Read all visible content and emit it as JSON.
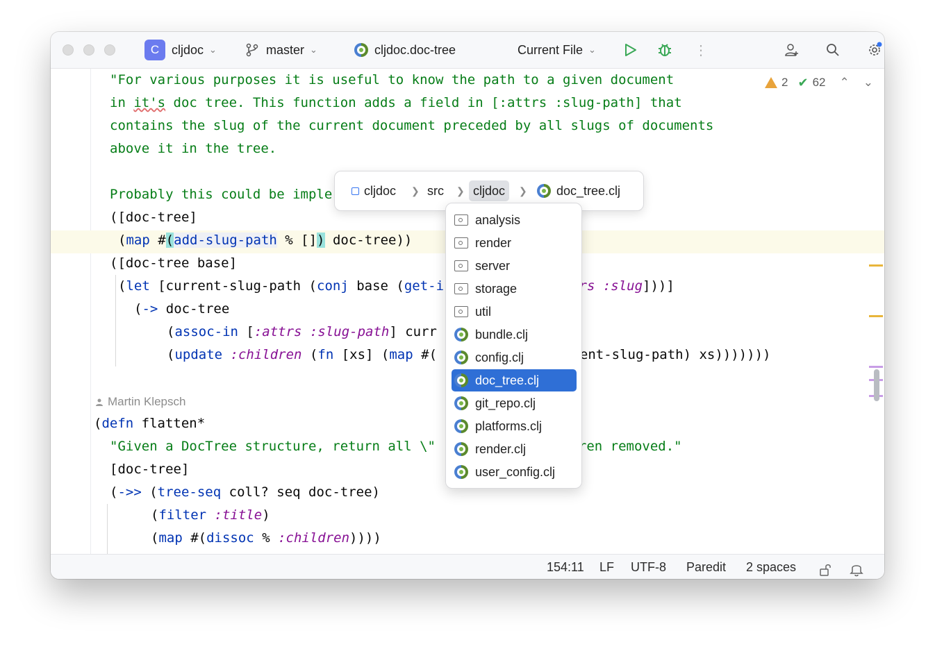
{
  "titlebar": {
    "project_initial": "C",
    "project_name": "cljdoc",
    "branch": "master",
    "current_namespace": "cljdoc.doc-tree",
    "run_config": "Current File"
  },
  "editor": {
    "inspections": {
      "warnings": "2",
      "checks": "62"
    },
    "author": "Martin Klepsch"
  },
  "breadcrumbs": {
    "items": [
      "cljdoc",
      "src",
      "cljdoc",
      "doc_tree.clj"
    ]
  },
  "dropdown": {
    "items": [
      {
        "label": "analysis",
        "icon": "folder-icon"
      },
      {
        "label": "render",
        "icon": "folder-icon"
      },
      {
        "label": "server",
        "icon": "folder-icon"
      },
      {
        "label": "storage",
        "icon": "folder-icon"
      },
      {
        "label": "util",
        "icon": "folder-icon"
      },
      {
        "label": "bundle.clj",
        "icon": "clojure-file-icon"
      },
      {
        "label": "config.clj",
        "icon": "clojure-file-icon"
      },
      {
        "label": "doc_tree.clj",
        "icon": "clojure-file-icon",
        "selected": true
      },
      {
        "label": "git_repo.clj",
        "icon": "clojure-file-icon"
      },
      {
        "label": "platforms.clj",
        "icon": "clojure-file-icon"
      },
      {
        "label": "render.clj",
        "icon": "clojure-file-icon"
      },
      {
        "label": "user_config.clj",
        "icon": "clojure-file-icon"
      }
    ]
  },
  "statusbar": {
    "position": "154:11",
    "line_separator": "LF",
    "encoding": "UTF-8",
    "mode": "Paredit",
    "indent": "2 spaces"
  },
  "colors": {
    "string": "#067d17",
    "keyword": "#0033b3",
    "clojure_keyword": "#871094",
    "selection": "#2f6fd6",
    "project_badge": "#6b7bef"
  }
}
